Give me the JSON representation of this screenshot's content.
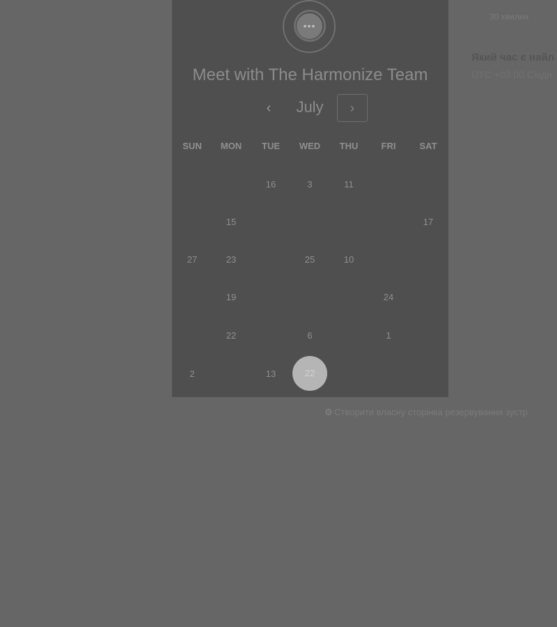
{
  "meeting": {
    "title": "Meet with The Harmonize Team",
    "logo_icon": "chat-bubble-icon",
    "logo_dots": "•••"
  },
  "calendar": {
    "month": "July",
    "prev_icon": "‹",
    "next_icon": "›",
    "weekdays": [
      "SUN",
      "MON",
      "TUE",
      "WED",
      "THU",
      "FRI",
      "SAT"
    ],
    "rows": [
      [
        "",
        "",
        "16",
        "3",
        "11",
        "",
        ""
      ],
      [
        "",
        "15",
        "",
        "",
        "",
        "",
        "17"
      ],
      [
        "27",
        "23",
        "",
        "25",
        "10",
        "",
        ""
      ],
      [
        "",
        "19",
        "",
        "",
        "",
        "24",
        ""
      ],
      [
        "",
        "22",
        "",
        "6",
        "",
        "1",
        ""
      ],
      [
        "2",
        "",
        "13",
        "22",
        "",
        "",
        ""
      ]
    ],
    "selected_day": "22"
  },
  "side_panel": {
    "duration": "30 хвилин",
    "question": "Який час є найл",
    "timezone": "UTC +03:00 Східн"
  },
  "footer": {
    "link_text": "Створити власну сторінка резервування зустр",
    "icon": "hubspot-sprocket-icon"
  }
}
